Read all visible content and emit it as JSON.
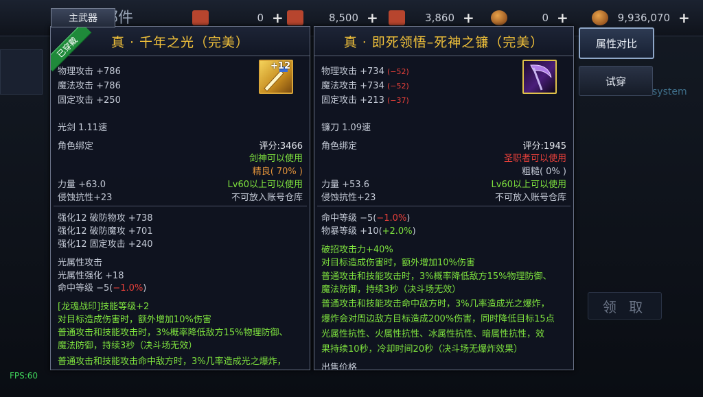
{
  "topbar": {
    "title": "部件",
    "currencies": [
      {
        "value": "0",
        "icon": "scroll-icon"
      },
      {
        "value": "8,500",
        "icon": "scroll-icon"
      },
      {
        "value": "3,860",
        "icon": "scroll-icon"
      },
      {
        "value": "0",
        "icon": "coin-icon"
      },
      {
        "value": "9,936,070",
        "icon": "gold-icon"
      }
    ],
    "plus": "+"
  },
  "right_buttons": {
    "compare": "属性对比",
    "try_on": "试穿",
    "system": "system",
    "claim": "领 取"
  },
  "fps": "FPS:60",
  "tag": "主武器",
  "equipped_ribbon": "已穿戴",
  "left": {
    "title": "真 · 千年之光（完美）",
    "icon_badge": "+12",
    "stats": [
      {
        "label": "物理攻击 +786"
      },
      {
        "label": "魔法攻击 +786"
      },
      {
        "label": "固定攻击 +250"
      }
    ],
    "weapon_type": "光剑 1.11速",
    "bind": "角色绑定",
    "score": "评分:3466",
    "usable_class": "剑神可以使用",
    "quality": "精良( 70% )",
    "str": "力量 +63.0",
    "level_req": "Lv60以上可以使用",
    "corrosion": "侵蚀抗性+23",
    "storage": "不可放入账号仓库",
    "enhance": [
      "强化12 破防物攻 +738",
      "强化12 破防魔攻 +701",
      "强化12 固定攻击 +240"
    ],
    "element_title": "光属性攻击",
    "element_enh": "光属性强化 +18",
    "hit_label": "命中等级 −5(",
    "hit_val": "−1.0%",
    "hit_close": ")",
    "effects": [
      "[龙魂战印]技能等级+2",
      "对目标造成伤害时，额外增加10%伤害",
      "普通攻击和技能攻击时，3%概率降低敌方15%物理防御、",
      "魔法防御，持续3秒（决斗场无效）",
      "普通攻击和技能攻击命中敌方时，3%几率造成光之爆炸，"
    ]
  },
  "right": {
    "title": "真 · 即死领悟–死神之镰（完美）",
    "stats": [
      {
        "label": "物理攻击 +734 ",
        "diff": "(−52)"
      },
      {
        "label": "魔法攻击 +734 ",
        "diff": "(−52)"
      },
      {
        "label": "固定攻击 +213 ",
        "diff": "(−37)"
      }
    ],
    "weapon_type": "镰刀 1.09速",
    "bind": "角色绑定",
    "score": "评分:1945",
    "usable_class": "圣职者可以使用",
    "quality": "粗糙( 0% )",
    "str": "力量 +53.6",
    "level_req": "Lv60以上可以使用",
    "corrosion": "侵蚀抗性+23",
    "storage": "不可放入账号仓库",
    "hit_label": "命中等级 −5(",
    "hit_val": "−1.0%",
    "hit_close": ")",
    "crit_label": "物暴等级 +10(",
    "crit_val": "+2.0%",
    "crit_close": ")",
    "effects": [
      "破招攻击力+40%",
      "对目标造成伤害时，额外增加10%伤害",
      "普通攻击和技能攻击时，3%概率降低敌方15%物理防御、",
      "魔法防御，持续3秒（决斗场无效）",
      "普通攻击和技能攻击命中敌方时，3%几率造成光之爆炸，",
      "爆炸会对周边敌方目标造成200%伤害，同时降低目标15点",
      "光属性抗性、火属性抗性、冰属性抗性、暗属性抗性，效",
      "果持续10秒，冷却时间20秒（决斗场无爆炸效果）"
    ],
    "sell_price": "出售价格"
  }
}
